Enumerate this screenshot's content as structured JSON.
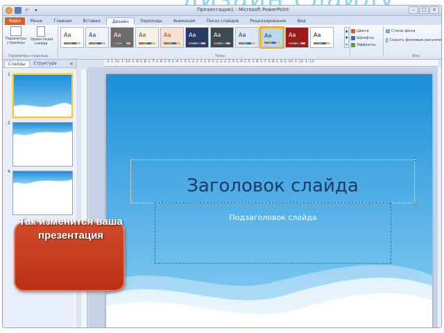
{
  "background": {
    "title_fragment": "дизайн слайду"
  },
  "window": {
    "title": "Презентация1 - Microsoft PowerPoint",
    "controls": [
      "–",
      "□",
      "×"
    ]
  },
  "quick_access": {
    "icons": [
      "app-logo",
      "save-icon",
      "undo-icon",
      "customize-icon"
    ]
  },
  "ribbon": {
    "tabs": [
      {
        "label": "Файл",
        "kind": "file"
      },
      {
        "label": "Меню",
        "kind": "normal"
      },
      {
        "label": "Главная",
        "kind": "normal"
      },
      {
        "label": "Вставка",
        "kind": "normal"
      },
      {
        "label": "Дизайн",
        "kind": "active"
      },
      {
        "label": "Переходы",
        "kind": "normal"
      },
      {
        "label": "Анимация",
        "kind": "normal"
      },
      {
        "label": "Показ слайдов",
        "kind": "normal"
      },
      {
        "label": "Рецензирование",
        "kind": "normal"
      },
      {
        "label": "Вид",
        "kind": "normal"
      }
    ],
    "page_setup": {
      "buttons": [
        "Параметры страницы",
        "Ориентация слайда"
      ],
      "group_label": "Параметры страницы"
    },
    "themes": {
      "group_label": "Темы",
      "items": [
        {
          "aa": "Aa",
          "bg": "#ffffff",
          "fg": "#333333"
        },
        {
          "aa": "Aa",
          "bg": "#eef3f8",
          "fg": "#1f3b66"
        },
        {
          "aa": "Aa",
          "bg": "#6b6b6b",
          "fg": "#ffffff"
        },
        {
          "aa": "Aa",
          "bg": "#f4f1e6",
          "fg": "#5c4a2a"
        },
        {
          "aa": "Aa",
          "bg": "#f3e2d2",
          "fg": "#a04216"
        },
        {
          "aa": "Aa",
          "bg": "#2b3a63",
          "fg": "#ffffff"
        },
        {
          "aa": "Aa",
          "bg": "#3d4a52",
          "fg": "#ffffff"
        },
        {
          "aa": "Aa",
          "bg": "#dbe9f5",
          "fg": "#1f3b66"
        },
        {
          "aa": "Aa",
          "bg": "#b8d9ef",
          "fg": "#1f3b66",
          "selected": true
        },
        {
          "aa": "Aa",
          "bg": "#9b1b1b",
          "fg": "#ffffff"
        },
        {
          "aa": "Aa",
          "bg": "#ffffff",
          "fg": "#111111"
        }
      ]
    },
    "theme_options": [
      {
        "label": "Цвета",
        "color": "#d55a3a"
      },
      {
        "label": "Шрифты",
        "color": "#3a6fb5"
      },
      {
        "label": "Эффекты",
        "color": "#5a9a3a"
      }
    ],
    "background_options": {
      "styles_label": "Стили фона",
      "hide_label": "Скрыть фоновые рисунки",
      "group_label": "Фон"
    }
  },
  "left_panel": {
    "tabs": [
      "Слайды",
      "Структура"
    ],
    "close": "×",
    "thumbnails": [
      {
        "number": "1",
        "selected": true
      },
      {
        "number": "2",
        "selected": false
      },
      {
        "number": "4",
        "selected": false
      }
    ]
  },
  "callout": {
    "text": "Так изменится ваша презентация"
  },
  "ruler": {
    "text": "·2·1·11·1·10·1·9·1·8·1·7·1·6·1·5·1·4·1·3·1·2·1·1·1·0·1·1·1·2·1·3·1·4·1·5·1·6·1·7·1·8·1·9·1·10·1·11·1·12·"
  },
  "slide": {
    "title": "Заголовок слайда",
    "subtitle": "Подзаголовок слайда",
    "colors": {
      "top": "#1b8fd9",
      "bottom": "#8fd0f3",
      "wave": "#ffffff"
    }
  }
}
